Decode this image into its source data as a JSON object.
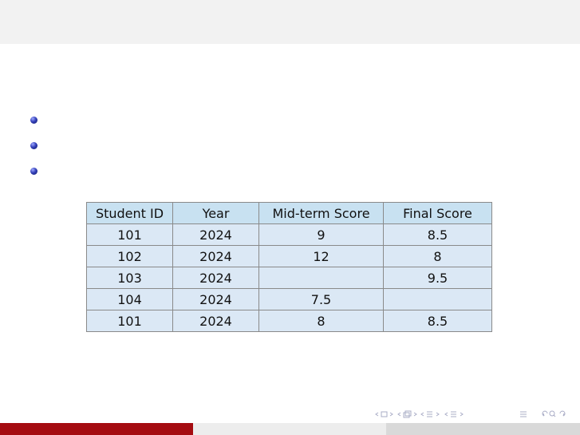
{
  "slide": {
    "bullets": [
      "",
      "",
      ""
    ]
  },
  "table": {
    "headers": [
      "Student ID",
      "Year",
      "Mid-term Score",
      "Final Score"
    ],
    "rows": [
      [
        "101",
        "2024",
        "9",
        "8.5"
      ],
      [
        "102",
        "2024",
        "12",
        "8"
      ],
      [
        "103",
        "2024",
        "",
        "9.5"
      ],
      [
        "104",
        "2024",
        "7.5",
        ""
      ],
      [
        "101",
        "2024",
        "8",
        "8.5"
      ]
    ]
  },
  "navigation": {
    "icons": [
      "frame-prev-icon",
      "frame-icon",
      "frame-next-icon",
      "subsection-prev-icon",
      "subsection-icon",
      "subsection-next-icon",
      "section-prev-icon",
      "section-icon",
      "section-next-icon",
      "subsubsection-prev-icon",
      "subsubsection-icon",
      "subsubsection-next-icon",
      "toc-icon",
      "back-icon",
      "search-icon",
      "forward-icon"
    ]
  },
  "colors": {
    "footer_accent": "#a50c11",
    "table_header": "#c8e1f1",
    "table_cell": "#dbe8f5",
    "bullet": "#3340b8"
  }
}
